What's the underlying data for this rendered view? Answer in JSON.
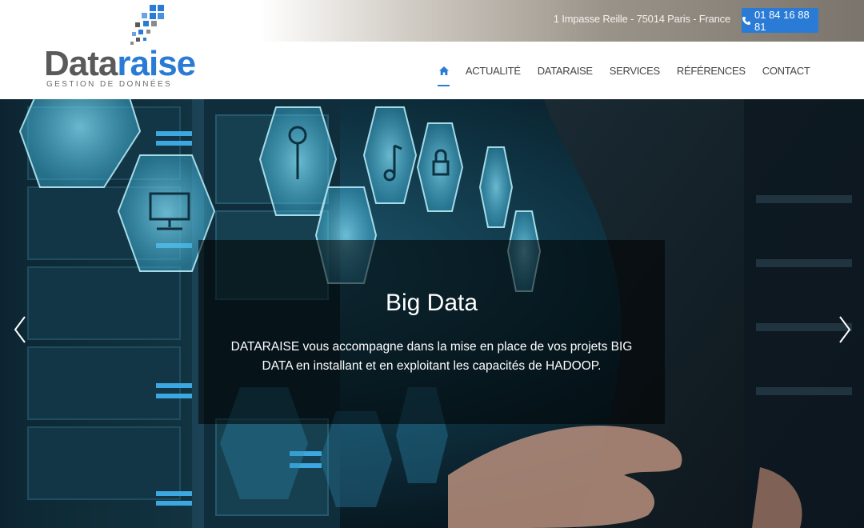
{
  "topbar": {
    "address": "1 Impasse Reille - 75014 Paris - France",
    "phone": "01 84 16 88 81",
    "phone_icon": "phone-icon"
  },
  "logo": {
    "word_part1": "Data",
    "word_part2": "raise",
    "tagline": "GESTION DE DONNÉES",
    "colors": {
      "grey": "#5a5a5a",
      "blue": "#2a7bd6"
    }
  },
  "nav": {
    "home_icon": "home-icon",
    "items": [
      "ACTUALITÉ",
      "DATARAISE",
      "SERVICES",
      "RÉFÉRENCES",
      "CONTACT"
    ]
  },
  "slide": {
    "title": "Big Data",
    "description": "DATARAISE vous accompagne dans la mise en place de vos projets BIG DATA en installant et en exploitant les capacités de HADOOP."
  },
  "carousel": {
    "prev_icon": "chevron-left-icon",
    "next_icon": "chevron-right-icon"
  },
  "colors": {
    "accent": "#2a7bd6"
  }
}
